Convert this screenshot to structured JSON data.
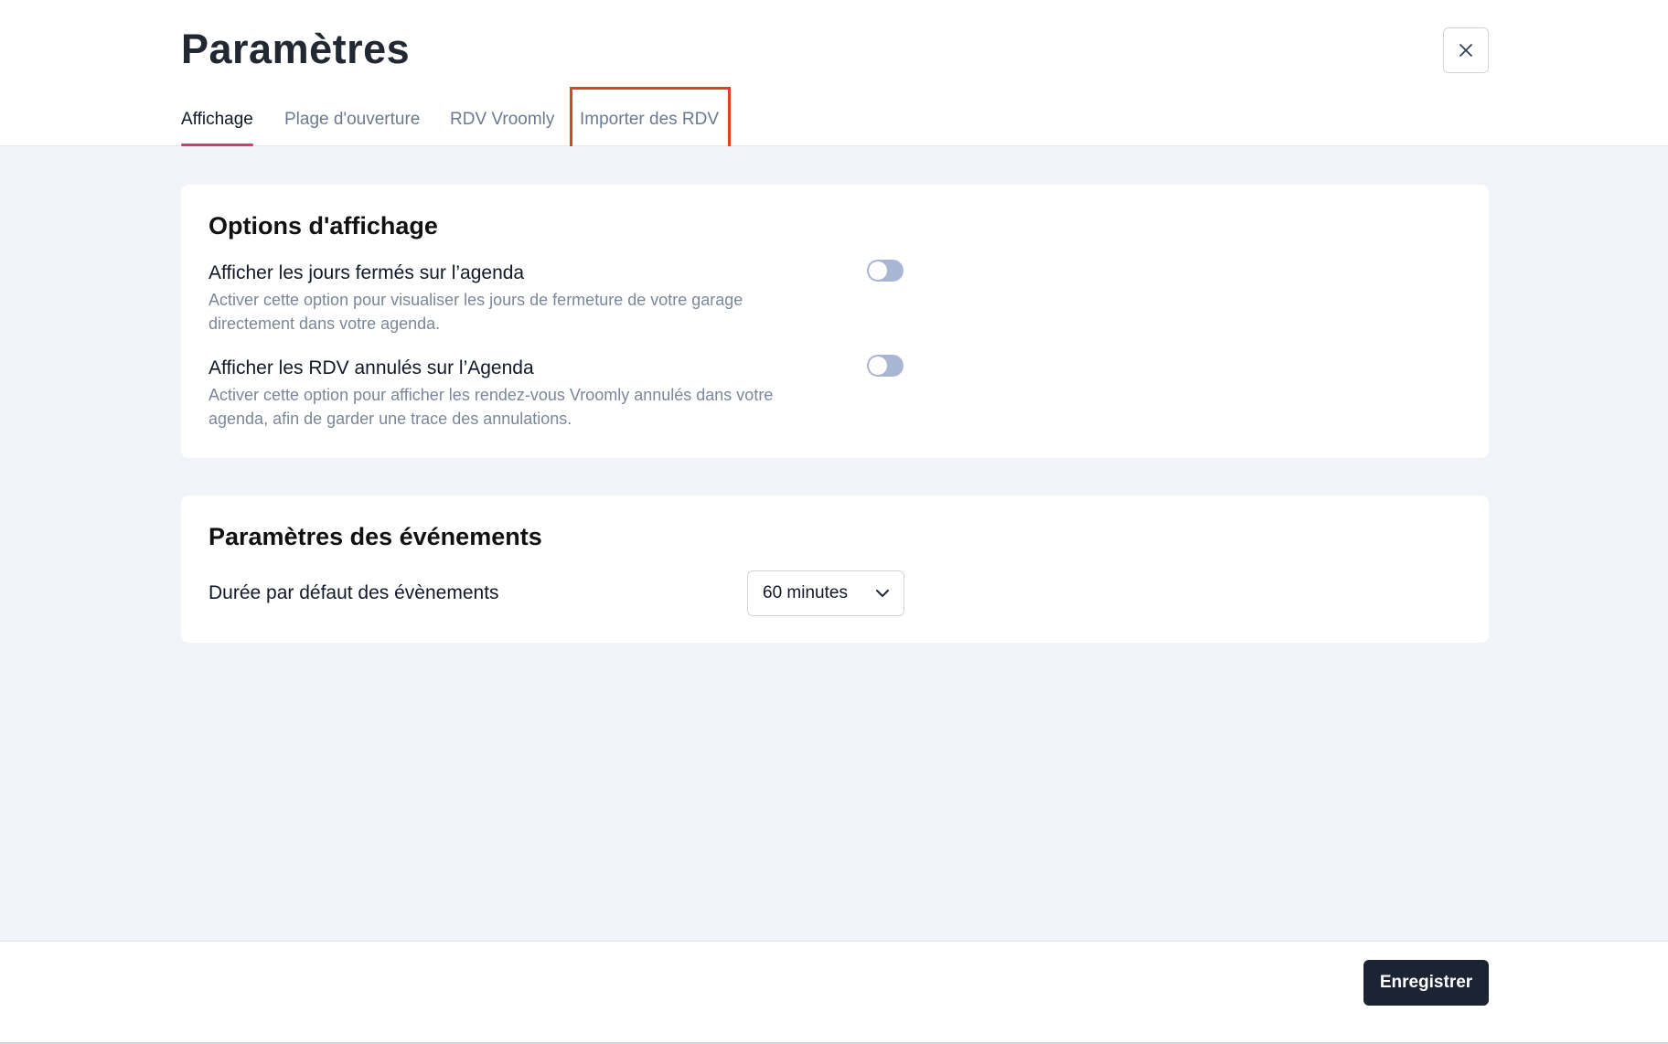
{
  "header": {
    "title": "Paramètres",
    "close_icon": "close-icon"
  },
  "tabs": [
    {
      "label": "Affichage",
      "active": true
    },
    {
      "label": "Plage d'ouverture",
      "active": false
    },
    {
      "label": "RDV Vroomly",
      "active": false
    },
    {
      "label": "Importer des RDV",
      "active": false,
      "highlighted": true
    }
  ],
  "display_options": {
    "title": "Options d'affichage",
    "options": [
      {
        "label": "Afficher les jours fermés sur l’agenda",
        "description_line1": "Activer cette option pour visualiser les jours de fermeture de votre garage",
        "description_line2": "directement dans votre agenda.",
        "enabled": false
      },
      {
        "label": "Afficher les RDV annulés sur l’Agenda",
        "description_line1": "Activer cette option pour afficher les rendez-vous Vroomly annulés dans votre",
        "description_line2": "agenda, afin de garder une trace des annulations.",
        "enabled": false
      }
    ]
  },
  "event_settings": {
    "title": "Paramètres des événements",
    "duration_label": "Durée par défaut des évènements",
    "duration_value": "60 minutes",
    "dropdown_icon": "chevron-down-icon"
  },
  "footer": {
    "save_label": "Enregistrer"
  },
  "colors": {
    "accent": "#d63a6a",
    "highlight": "#e0402a",
    "toggle_off": "#a9b6d3",
    "primary_button": "#1c2434",
    "background": "#f0f3f7"
  }
}
